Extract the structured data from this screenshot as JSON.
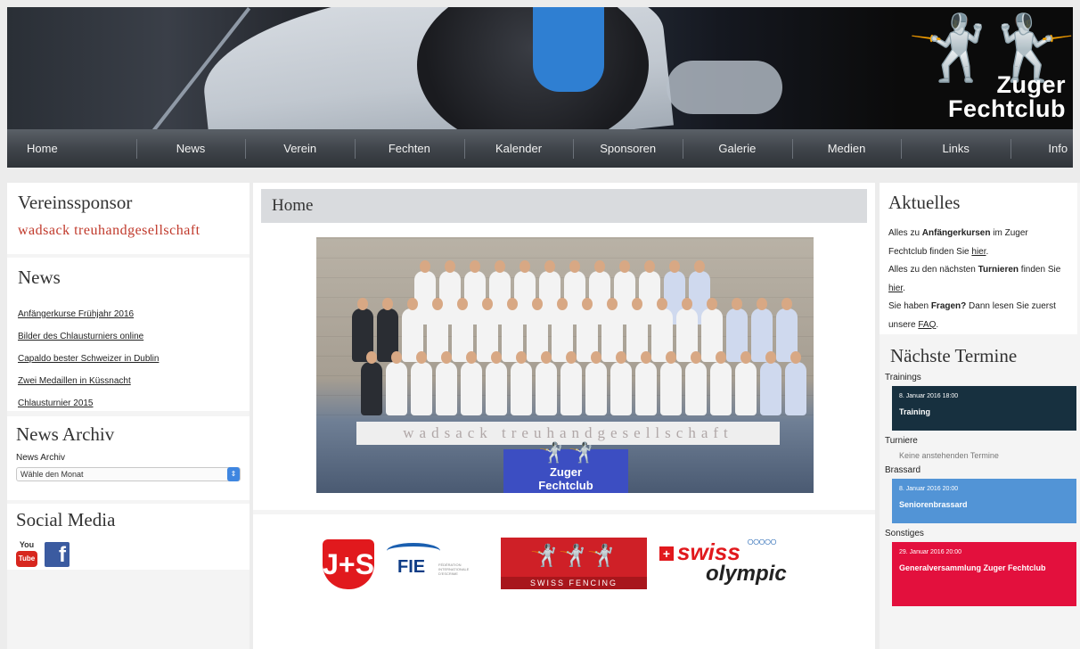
{
  "header": {
    "logo_line1": "Zuger",
    "logo_line2": "Fechtclub"
  },
  "nav": {
    "items": [
      "Home",
      "News",
      "Verein",
      "Fechten",
      "Kalender",
      "Sponsoren",
      "Galerie",
      "Medien",
      "Links",
      "Info"
    ]
  },
  "left": {
    "sponsor_heading": "Vereinssponsor",
    "sponsor_name": "wadsack treuhandgesellschaft",
    "news_heading": "News",
    "news_items": [
      "Anfängerkurse Frühjahr 2016",
      "Bilder des Chlausturniers online",
      "Capaldo bester Schweizer in Dublin",
      "Zwei Medaillen in Küssnacht",
      "Chlausturnier 2015"
    ],
    "archive_heading": "News Archiv",
    "archive_label": "News Archiv",
    "archive_select_value": "Wähle den Monat",
    "social_heading": "Social Media",
    "youtube_top": "You",
    "youtube_bottom": "Tube",
    "facebook_letter": "f"
  },
  "main": {
    "page_title": "Home",
    "photo_banner": "wadsack treuhandgesellschaft",
    "mat_line1": "Zuger",
    "mat_line2": "Fechtclub",
    "logos": {
      "js_text": "J+S",
      "fie_text": "FIE",
      "fie_sub": "FÉDÉRATION INTERNATIONALE D'ESCRIME",
      "swiss_fencing_text": "SWISS FENCING",
      "swiss_olympic_swiss": "swiss",
      "swiss_olympic_olympic": "olympic"
    }
  },
  "right": {
    "aktuelles_heading": "Aktuelles",
    "aktuelles_p1_pre": "Alles zu ",
    "aktuelles_p1_bold": "Anfängerkursen",
    "aktuelles_p1_mid": " im Zuger Fechtclub finden Sie ",
    "aktuelles_p1_link": "hier",
    "aktuelles_p1_end": ".",
    "aktuelles_p2_pre": "Alles zu den nächsten ",
    "aktuelles_p2_bold": "Turnieren",
    "aktuelles_p2_mid": " finden Sie ",
    "aktuelles_p2_link": "hier",
    "aktuelles_p2_end": ".",
    "aktuelles_p3_pre": "Sie haben ",
    "aktuelles_p3_bold": "Fragen?",
    "aktuelles_p3_mid": " Dann lesen Sie zuerst unsere ",
    "aktuelles_p3_link": "FAQ",
    "aktuelles_p3_end": ".",
    "termine_heading": "Nächste Termine",
    "cat_trainings": "Trainings",
    "ev1_date": "8. Januar 2016 18:00",
    "ev1_title": "Training",
    "cat_turniere": "Turniere",
    "no_events": "Keine anstehenden Termine",
    "cat_brassard": "Brassard",
    "ev2_date": "8. Januar 2016 20:00",
    "ev2_title": "Seniorenbrassard",
    "cat_sonstiges": "Sonstiges",
    "ev3_date": "29. Januar 2016 20:00",
    "ev3_title": "Generalversammlung Zuger Fechtclub"
  },
  "colors": {
    "nav_bg": "#40454b",
    "sponsor_red": "#c0392b",
    "event_dark": "#17303f",
    "event_blue": "#5294d6",
    "event_red": "#e3103d"
  }
}
